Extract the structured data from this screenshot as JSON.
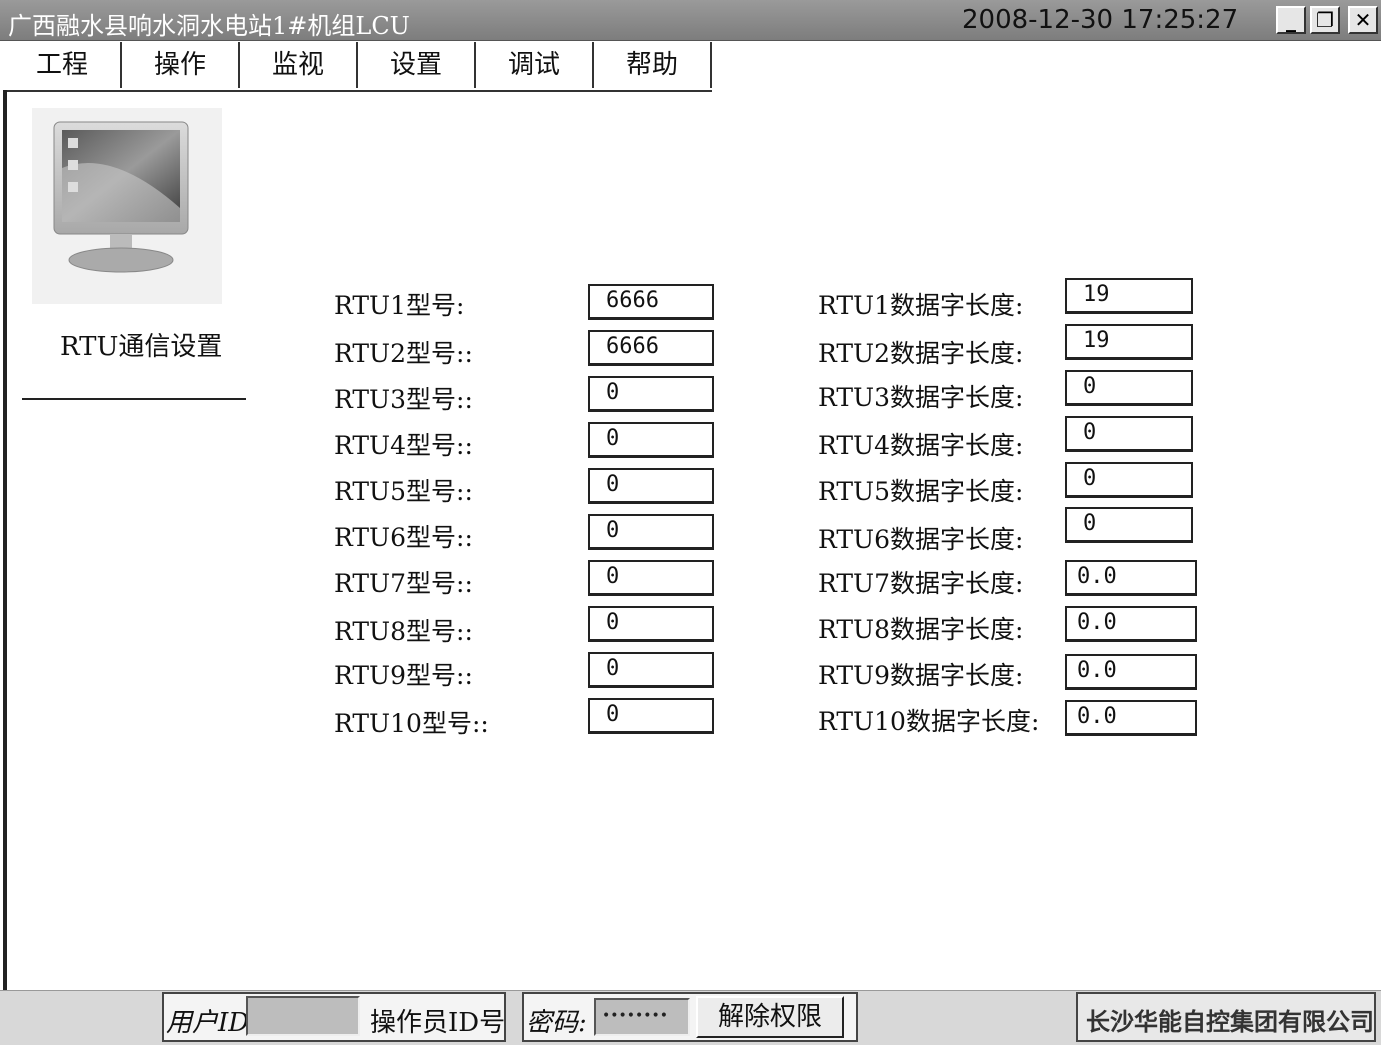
{
  "window": {
    "title": "广西融水县响水洞水电站1#机组LCU",
    "clock": "2008-12-30 17:25:27",
    "min_glyph": "_",
    "restore_glyph": "❐",
    "close_glyph": "✕"
  },
  "menu": [
    "工程",
    "操作",
    "监视",
    "设置",
    "调试",
    "帮助"
  ],
  "panel": {
    "title": "RTU通信设置"
  },
  "rtu": [
    {
      "model_label": "RTU1型号:",
      "model_value": "6666",
      "len_label": "RTU1数据字长度:",
      "len_value": "19"
    },
    {
      "model_label": "RTU2型号::",
      "model_value": "6666",
      "len_label": "RTU2数据字长度:",
      "len_value": "19"
    },
    {
      "model_label": "RTU3型号::",
      "model_value": "0",
      "len_label": "RTU3数据字长度:",
      "len_value": "0"
    },
    {
      "model_label": "RTU4型号::",
      "model_value": "0",
      "len_label": "RTU4数据字长度:",
      "len_value": "0"
    },
    {
      "model_label": "RTU5型号::",
      "model_value": "0",
      "len_label": "RTU5数据字长度:",
      "len_value": "0"
    },
    {
      "model_label": "RTU6型号::",
      "model_value": "0",
      "len_label": "RTU6数据字长度:",
      "len_value": "0"
    },
    {
      "model_label": "RTU7型号::",
      "model_value": "0",
      "len_label": "RTU7数据字长度:",
      "len_value": "0.0"
    },
    {
      "model_label": "RTU8型号::",
      "model_value": "0",
      "len_label": "RTU8数据字长度:",
      "len_value": "0.0"
    },
    {
      "model_label": "RTU9型号::",
      "model_value": "0",
      "len_label": "RTU9数据字长度:",
      "len_value": "0.0"
    },
    {
      "model_label": "RTU10型号::",
      "model_value": "0",
      "len_label": "RTU10数据字长度:",
      "len_value": "0.0"
    }
  ],
  "status": {
    "user_id_label": "用户ID",
    "operator_id_label": "操作员ID号",
    "password_label": "密码:",
    "password_value": "••••••••",
    "unlock_label": "解除权限",
    "company": "长沙华能自控集团有限公司"
  }
}
